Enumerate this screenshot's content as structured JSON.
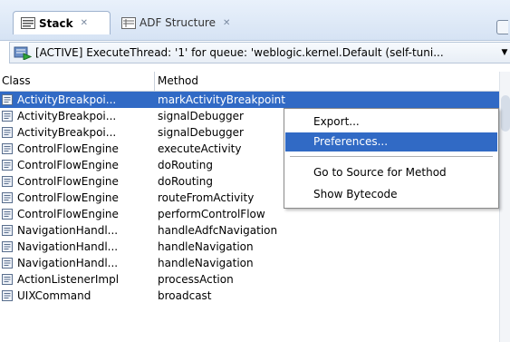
{
  "tabs": [
    {
      "label": "Stack",
      "icon": "stack-icon",
      "active": true
    },
    {
      "label": "ADF Structure",
      "icon": "adf-structure-icon",
      "active": false
    }
  ],
  "thread_selector": {
    "icon": "thread-icon",
    "value": "[ACTIVE] ExecuteThread: '1' for queue: 'weblogic.kernel.Default (self-tuni..."
  },
  "table": {
    "columns": [
      "Class",
      "Method"
    ],
    "rows": [
      {
        "class": "ActivityBreakpoi...",
        "method": "markActivityBreakpoint",
        "selected": true
      },
      {
        "class": "ActivityBreakpoi...",
        "method": "signalDebugger"
      },
      {
        "class": "ActivityBreakpoi...",
        "method": "signalDebugger"
      },
      {
        "class": "ControlFlowEngine",
        "method": "executeActivity"
      },
      {
        "class": "ControlFlowEngine",
        "method": "doRouting"
      },
      {
        "class": "ControlFlowEngine",
        "method": "doRouting"
      },
      {
        "class": "ControlFlowEngine",
        "method": "routeFromActivity"
      },
      {
        "class": "ControlFlowEngine",
        "method": "performControlFlow"
      },
      {
        "class": "NavigationHandl...",
        "method": "handleAdfcNavigation"
      },
      {
        "class": "NavigationHandl...",
        "method": "handleNavigation"
      },
      {
        "class": "NavigationHandl...",
        "method": "handleNavigation"
      },
      {
        "class": "ActionListenerImpl",
        "method": "processAction"
      },
      {
        "class": "UIXCommand",
        "method": "broadcast"
      }
    ]
  },
  "context_menu": {
    "items": [
      "Export...",
      "Preferences...",
      "Go to Source for Method",
      "Show Bytecode"
    ],
    "highlighted": "Preferences..."
  },
  "colors": {
    "selection": "#316ac5",
    "tab_bar": "#d6e3f4"
  }
}
